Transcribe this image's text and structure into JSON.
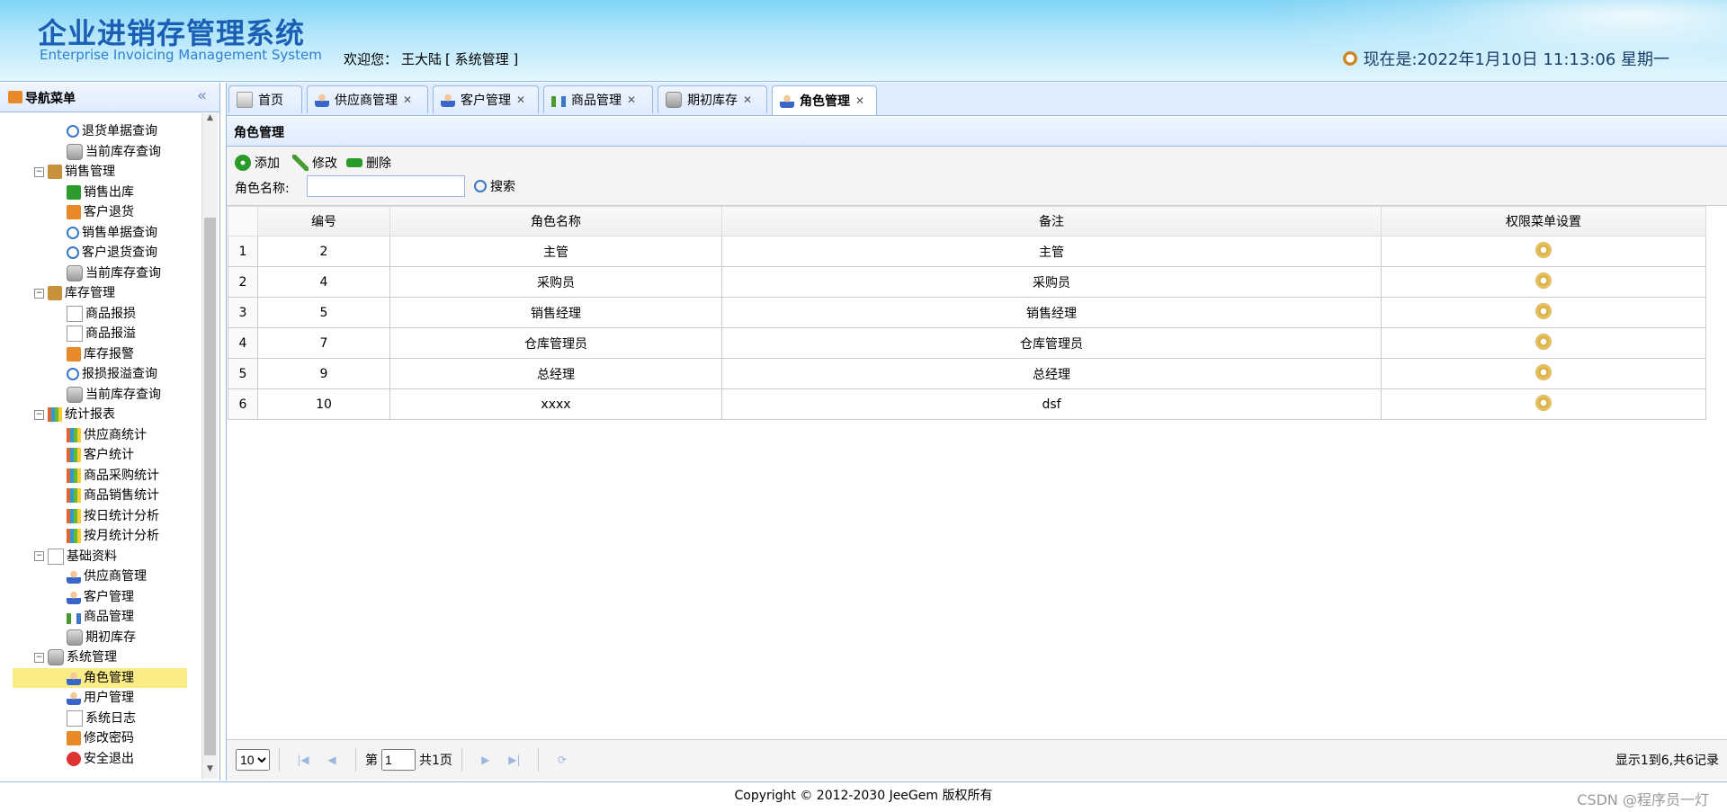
{
  "header": {
    "title_cn": "企业进销存管理系统",
    "title_en": "Enterprise Invoicing Management System",
    "welcome_label": "欢迎您：",
    "user_name": "王大陆",
    "user_role": "[ 系统管理 ]",
    "clock_text": "现在是:2022年1月10日 11:13:06 星期一"
  },
  "nav": {
    "title": "导航菜单",
    "collapse_icon": "«",
    "items": [
      {
        "label": "退货单据查询",
        "level": 2,
        "icon": "search-icon"
      },
      {
        "label": "当前库存查询",
        "level": 2,
        "icon": "db-icon"
      },
      {
        "label": "销售管理",
        "level": 1,
        "icon": "folder-icon"
      },
      {
        "label": "销售出库",
        "level": 2,
        "icon": "green-arrow-icon"
      },
      {
        "label": "客户退货",
        "level": 2,
        "icon": "orange-arrow-icon"
      },
      {
        "label": "销售单据查询",
        "level": 2,
        "icon": "search-icon"
      },
      {
        "label": "客户退货查询",
        "level": 2,
        "icon": "search-icon"
      },
      {
        "label": "当前库存查询",
        "level": 2,
        "icon": "db-icon"
      },
      {
        "label": "库存管理",
        "level": 1,
        "icon": "folder-icon"
      },
      {
        "label": "商品报损",
        "level": 2,
        "icon": "doc-icon"
      },
      {
        "label": "商品报溢",
        "level": 2,
        "icon": "doc-icon"
      },
      {
        "label": "库存报警",
        "level": 2,
        "icon": "alarm-icon"
      },
      {
        "label": "报损报溢查询",
        "level": 2,
        "icon": "search-icon"
      },
      {
        "label": "当前库存查询",
        "level": 2,
        "icon": "db-icon"
      },
      {
        "label": "统计报表",
        "level": 1,
        "icon": "chart-icon"
      },
      {
        "label": "供应商统计",
        "level": 2,
        "icon": "chart-icon"
      },
      {
        "label": "客户统计",
        "level": 2,
        "icon": "chart-icon"
      },
      {
        "label": "商品采购统计",
        "level": 2,
        "icon": "chart-icon"
      },
      {
        "label": "商品销售统计",
        "level": 2,
        "icon": "chart-icon"
      },
      {
        "label": "按日统计分析",
        "level": 2,
        "icon": "chart-icon"
      },
      {
        "label": "按月统计分析",
        "level": 2,
        "icon": "chart-icon"
      },
      {
        "label": "基础资料",
        "level": 1,
        "icon": "doc-icon"
      },
      {
        "label": "供应商管理",
        "level": 2,
        "icon": "user-icon"
      },
      {
        "label": "客户管理",
        "level": 2,
        "icon": "user-icon"
      },
      {
        "label": "商品管理",
        "level": 2,
        "icon": "tree-icon"
      },
      {
        "label": "期初库存",
        "level": 2,
        "icon": "db-icon"
      },
      {
        "label": "系统管理",
        "level": 1,
        "icon": "computer-icon"
      },
      {
        "label": "角色管理",
        "level": 2,
        "icon": "user-icon",
        "selected": true
      },
      {
        "label": "用户管理",
        "level": 2,
        "icon": "users-icon"
      },
      {
        "label": "系统日志",
        "level": 2,
        "icon": "log-icon"
      },
      {
        "label": "修改密码",
        "level": 2,
        "icon": "lock-icon"
      },
      {
        "label": "安全退出",
        "level": 2,
        "icon": "exit-icon"
      }
    ]
  },
  "tabs": [
    {
      "label": "首页",
      "icon": "home-icon",
      "closable": false
    },
    {
      "label": "供应商管理",
      "icon": "user-icon",
      "closable": true
    },
    {
      "label": "客户管理",
      "icon": "user-icon",
      "closable": true
    },
    {
      "label": "商品管理",
      "icon": "tree-icon",
      "closable": true
    },
    {
      "label": "期初库存",
      "icon": "db-icon",
      "closable": true
    },
    {
      "label": "角色管理",
      "icon": "user-icon",
      "closable": true,
      "active": true
    }
  ],
  "panel": {
    "title": "角色管理",
    "toolbar": {
      "add": "添加",
      "edit": "修改",
      "delete": "删除"
    },
    "search_label": "角色名称:",
    "search_value": "",
    "search_button": "搜索"
  },
  "grid": {
    "columns": [
      "编号",
      "角色名称",
      "备注",
      "权限菜单设置"
    ],
    "rows": [
      {
        "rn": "1",
        "id": "2",
        "name": "主管",
        "remark": "主管"
      },
      {
        "rn": "2",
        "id": "4",
        "name": "采购员",
        "remark": "采购员"
      },
      {
        "rn": "3",
        "id": "5",
        "name": "销售经理",
        "remark": "销售经理"
      },
      {
        "rn": "4",
        "id": "7",
        "name": "仓库管理员",
        "remark": "仓库管理员"
      },
      {
        "rn": "5",
        "id": "9",
        "name": "总经理",
        "remark": "总经理"
      },
      {
        "rn": "6",
        "id": "10",
        "name": "xxxx",
        "remark": "dsf"
      }
    ]
  },
  "pager": {
    "page_size": "10",
    "page_prefix": "第",
    "page_value": "1",
    "page_suffix": "共1页",
    "summary": "显示1到6,共6记录"
  },
  "footer": {
    "copyright": "Copyright © 2012-2030 JeeGem 版权所有",
    "watermark": "CSDN @程序员一灯"
  }
}
